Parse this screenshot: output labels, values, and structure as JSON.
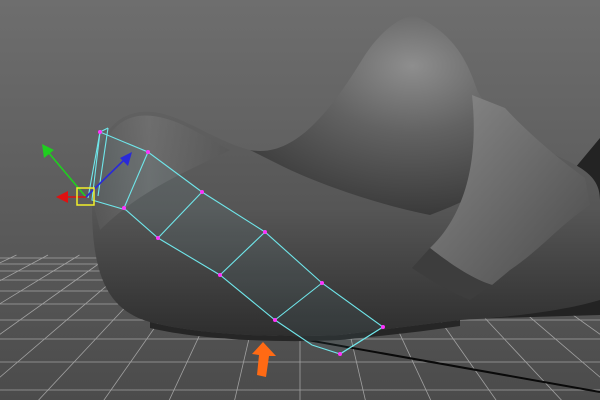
{
  "viewport": {
    "type": "3d-perspective-viewport",
    "background_top": "#6e6e6e",
    "background_bottom": "#4b4b4b",
    "grid_color": "#bdbdbd",
    "origin_axis_color": "#0a0a0a"
  },
  "model": {
    "shape": "shoe-last",
    "body_color": "#5b5b5b",
    "highlight_color": "#8c8c8c",
    "shadow_color": "#2c2c2c"
  },
  "selection": {
    "wire_color": "#6fe6ea",
    "vertex_color": "#ff33ff",
    "face_rows_selected": 5
  },
  "manipulator": {
    "x_axis_color": "#e01010",
    "y_axis_color": "#1fcf1f",
    "z_axis_color": "#2a2ad8",
    "center_handle_color": "#f2ef2a"
  },
  "annotation": {
    "arrow_color": "#ff6a14",
    "direction": "up"
  }
}
